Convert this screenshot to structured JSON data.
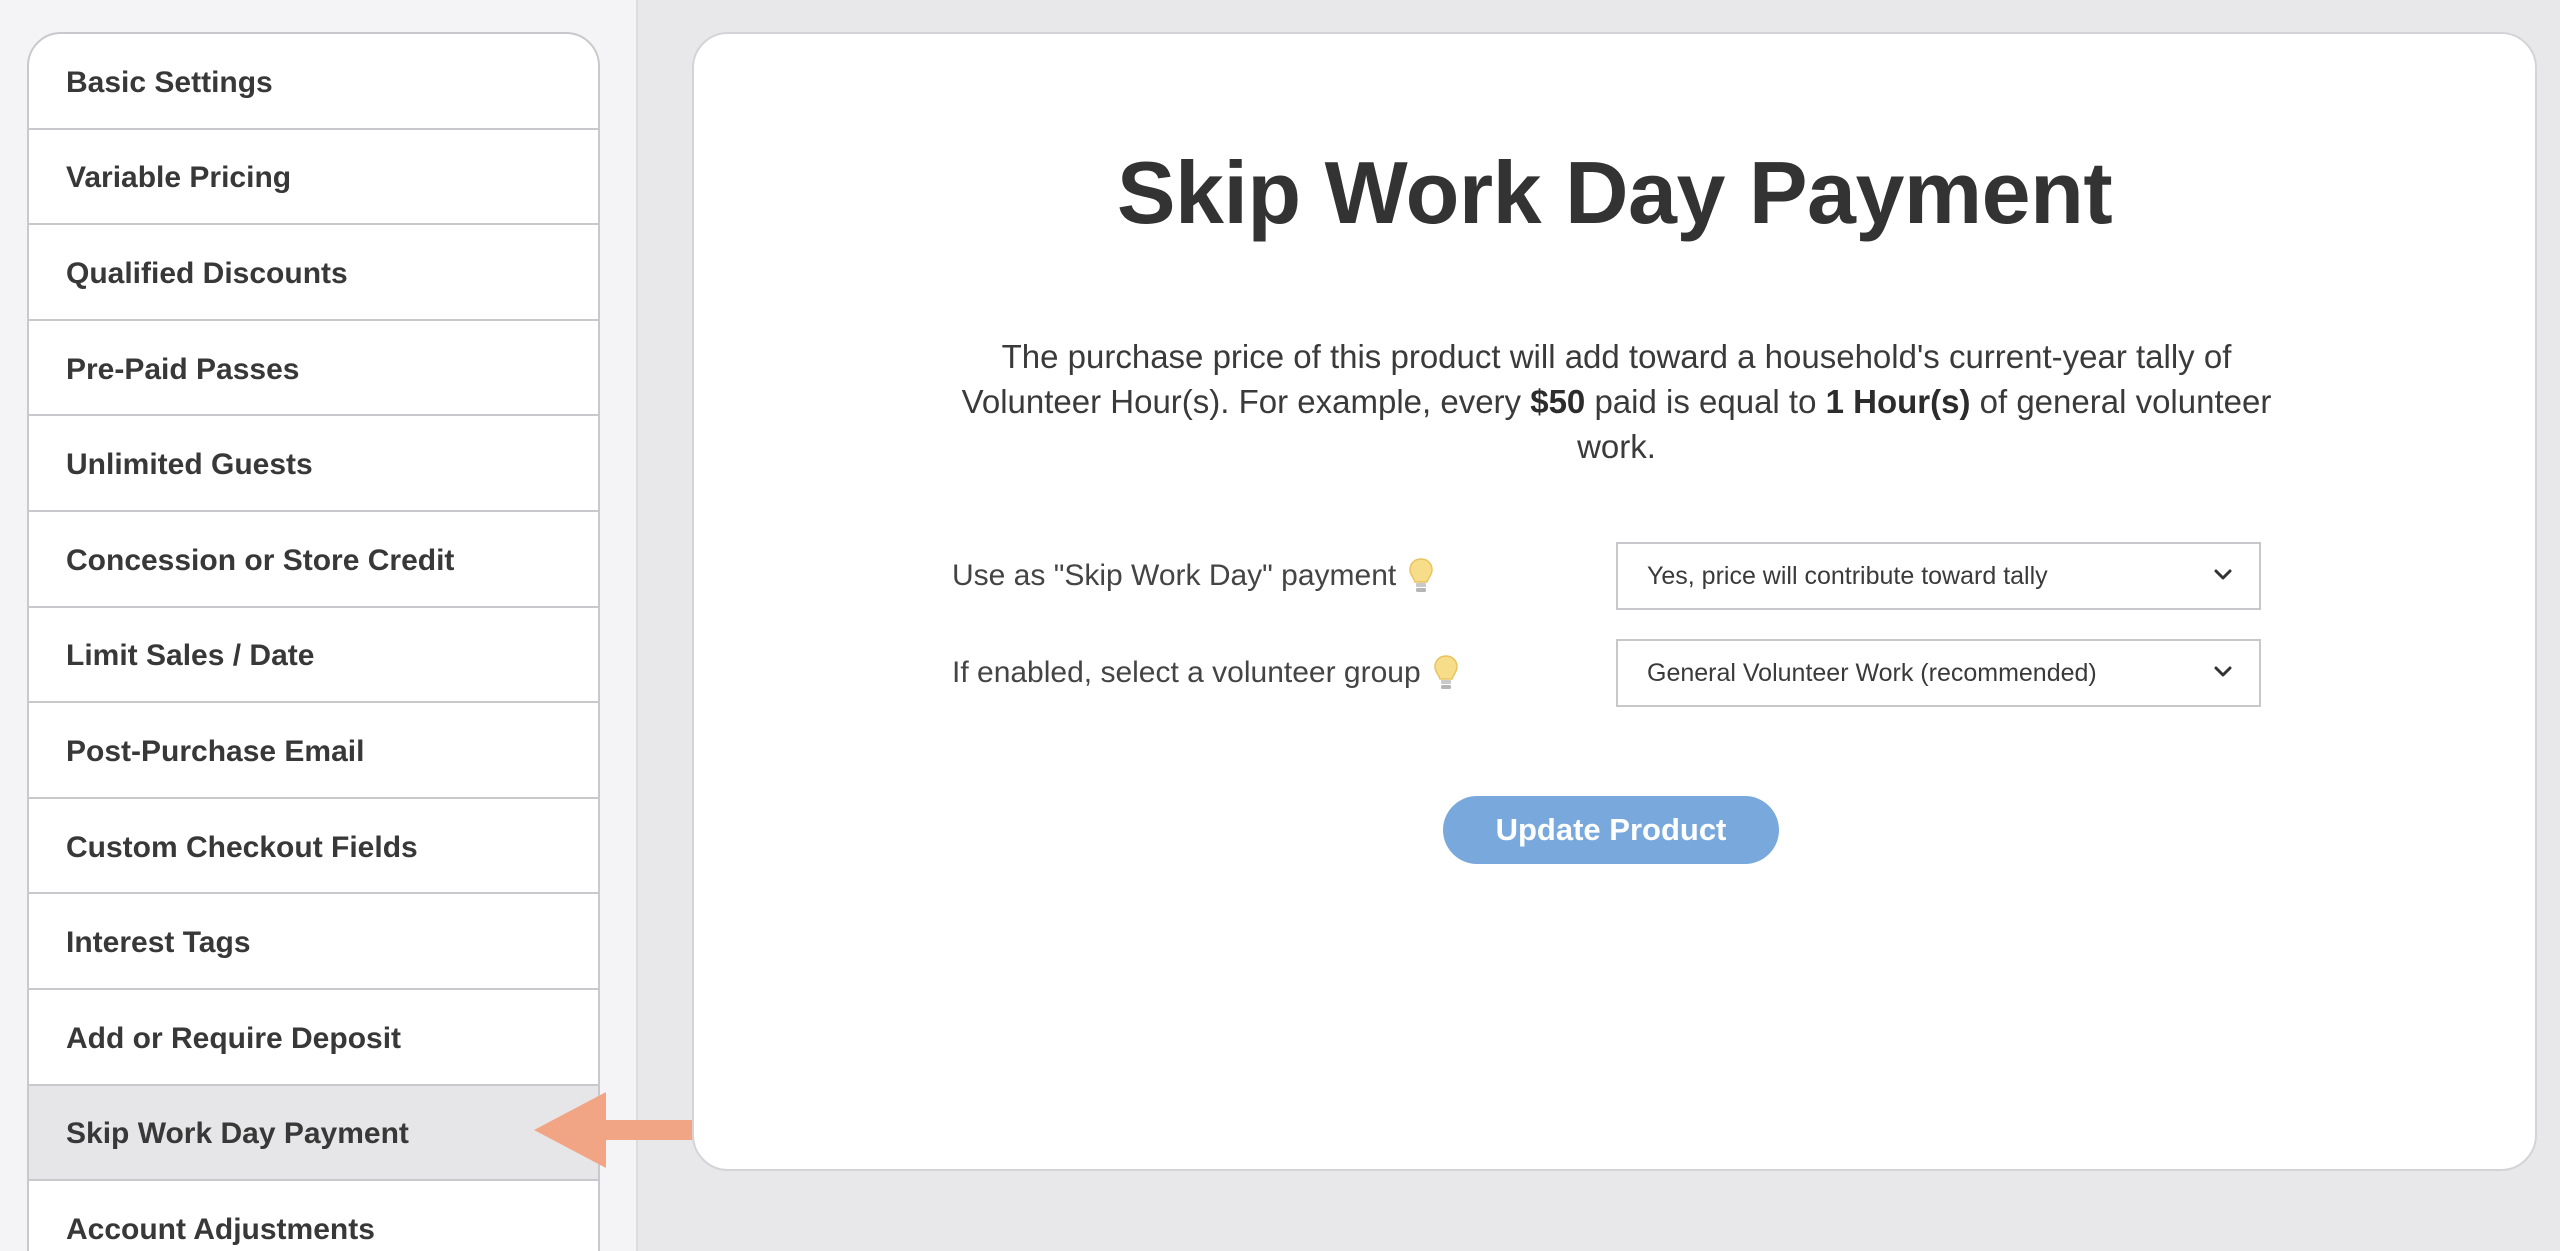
{
  "sidebar": {
    "items": [
      {
        "label": "Basic Settings"
      },
      {
        "label": "Variable Pricing"
      },
      {
        "label": "Qualified Discounts"
      },
      {
        "label": "Pre-Paid Passes"
      },
      {
        "label": "Unlimited Guests"
      },
      {
        "label": "Concession or Store Credit"
      },
      {
        "label": "Limit Sales / Date"
      },
      {
        "label": "Post-Purchase Email"
      },
      {
        "label": "Custom Checkout Fields"
      },
      {
        "label": "Interest Tags"
      },
      {
        "label": "Add or Require Deposit"
      },
      {
        "label": "Skip Work Day Payment",
        "active": true
      },
      {
        "label": "Account Adjustments"
      }
    ]
  },
  "main": {
    "title": "Skip Work Day Payment",
    "description": {
      "part1": "The purchase price of this product will add toward a household's current-year tally of Volunteer Hour(s). For example, every ",
      "amount": "$50",
      "part2": " paid is equal to ",
      "hours": "1 Hour(s)",
      "part3": " of general volunteer work."
    },
    "fields": {
      "skip_work_day": {
        "label": "Use as \"Skip Work Day\" payment",
        "value": "Yes, price will contribute toward tally",
        "icon": "lightbulb-icon"
      },
      "volunteer_group": {
        "label": "If enabled, select a volunteer group",
        "value": "General Volunteer Work (recommended)",
        "icon": "lightbulb-icon"
      }
    },
    "update_button": "Update Product"
  },
  "colors": {
    "button": "#79a9dc",
    "arrow": "#f2a585",
    "active_item": "#e6e6e8",
    "bulb": "#f7dc8a"
  }
}
